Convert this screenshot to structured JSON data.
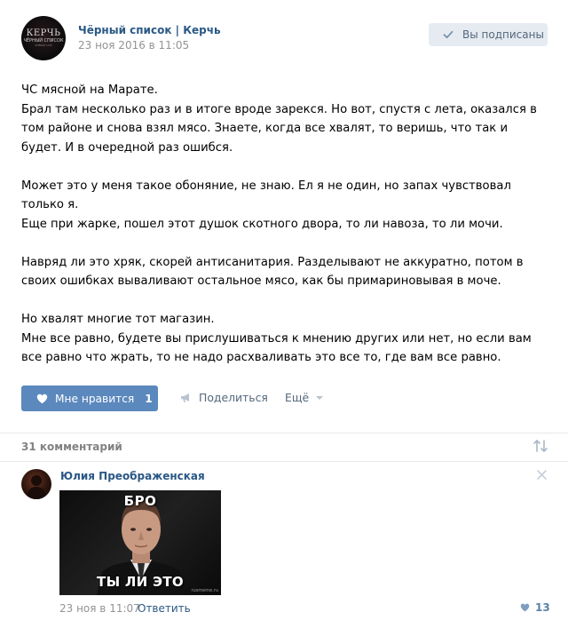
{
  "post": {
    "group_name": "Чёрный список | Керчь",
    "date": "23 ноя 2016 в 11:05",
    "avatar_text": [
      "КЕРЧЬ",
      "ЧЁРНЫЙ СПИСОК",
      "CHERNY LIST"
    ],
    "subscribed_label": "Вы подписаны",
    "paragraphs": [
      "ЧС мясной на Марате.\nБрал там несколько раз и в итоге вроде зарекся. Но вот, спустя с лета, оказался в том районе и снова взял мясо. Знаете, когда все хвалят, то веришь, что так и будет. И в очередной раз ошибся.",
      "Может это у меня такое обоняние, не знаю. Ел я не один, но запах чувствовал только я.\nЕще при жарке, пошел этот душок скотного двора, то ли навоза, то ли мочи.",
      "Навряд ли это хряк, скорей антисанитария. Разделывают не аккуратно, потом в своих ошибках вываливают остальное мясо, как бы примариновывая в моче.",
      "Но хвалят многие тот магазин.\nМне все равно, будете вы прислушиваться к мнению других или нет, но если вам все равно что жрать, то не надо расхваливать это все то, где вам все равно."
    ],
    "actions": {
      "like_label": "Мне нравится",
      "like_count": "1",
      "share_label": "Поделиться",
      "more_label": "Ещё"
    }
  },
  "comments_header": {
    "count_label": "31 комментарий"
  },
  "comment": {
    "author": "Юлия Преображенская",
    "meme_top": "БРО",
    "meme_bottom": "ТЫ ЛИ ЭТО",
    "meme_watermark": "rusmeme.ru",
    "date": "23 ноя в 11:07",
    "reply_label": "Ответить",
    "likes": "13"
  },
  "colors": {
    "link": "#2a5885",
    "like_button": "#5b88bd",
    "muted": "#939393",
    "button_bg": "#e5ebf1"
  },
  "icons": [
    "check-icon",
    "heart-icon",
    "megaphone-icon",
    "caret-down-icon",
    "sort-icon",
    "close-icon"
  ]
}
